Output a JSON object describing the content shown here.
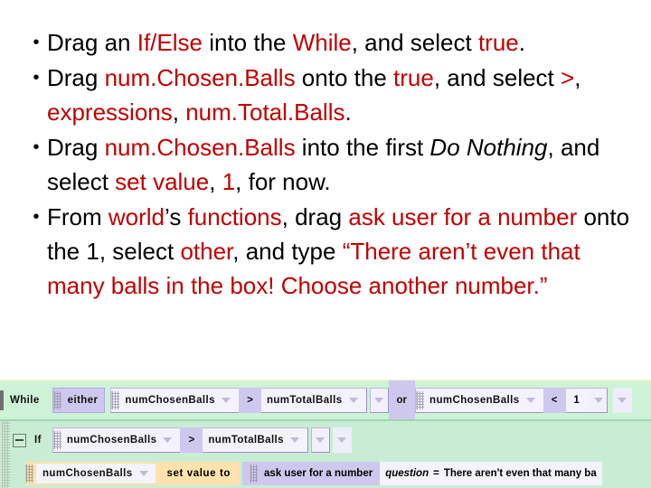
{
  "slide": {
    "bullets": [
      {
        "marker": "•",
        "runs": [
          {
            "t": "Drag an ",
            "s": "plain"
          },
          {
            "t": "If/Else",
            "s": "em"
          },
          {
            "t": " into the ",
            "s": "plain"
          },
          {
            "t": "While",
            "s": "em"
          },
          {
            "t": ", and select ",
            "s": "plain"
          },
          {
            "t": "true",
            "s": "em"
          },
          {
            "t": ".",
            "s": "plain"
          }
        ]
      },
      {
        "marker": "•",
        "runs": [
          {
            "t": "Drag ",
            "s": "plain"
          },
          {
            "t": "num.Chosen.Balls",
            "s": "em"
          },
          {
            "t": " onto the ",
            "s": "plain"
          },
          {
            "t": "true",
            "s": "em"
          },
          {
            "t": ", and select ",
            "s": "plain"
          },
          {
            "t": ">",
            "s": "em"
          },
          {
            "t": ", ",
            "s": "plain"
          },
          {
            "t": "expressions",
            "s": "em"
          },
          {
            "t": ", ",
            "s": "plain"
          },
          {
            "t": "num.Total.Balls",
            "s": "em"
          },
          {
            "t": ".",
            "s": "plain"
          }
        ]
      },
      {
        "marker": "•",
        "runs": [
          {
            "t": "Drag ",
            "s": "plain"
          },
          {
            "t": "num.Chosen.Balls",
            "s": "em"
          },
          {
            "t": " into the first ",
            "s": "plain"
          },
          {
            "t": "Do Nothing",
            "s": "it"
          },
          {
            "t": ", and select ",
            "s": "plain"
          },
          {
            "t": "set value",
            "s": "em"
          },
          {
            "t": ", ",
            "s": "plain"
          },
          {
            "t": "1",
            "s": "em"
          },
          {
            "t": ", for now.",
            "s": "plain"
          }
        ]
      },
      {
        "marker": "•",
        "runs": [
          {
            "t": "From ",
            "s": "plain"
          },
          {
            "t": "world",
            "s": "em"
          },
          {
            "t": "’s ",
            "s": "plain"
          },
          {
            "t": "functions",
            "s": "em"
          },
          {
            "t": ", drag ",
            "s": "plain"
          },
          {
            "t": "ask user for a number",
            "s": "em"
          },
          {
            "t": " onto the ",
            "s": "plain"
          },
          {
            "t": "1",
            "s": "plain"
          },
          {
            "t": ", select ",
            "s": "plain"
          },
          {
            "t": "other",
            "s": "em"
          },
          {
            "t": ", and type ",
            "s": "plain"
          },
          {
            "t": "“There aren’t even that many balls in the box! Choose another number.”",
            "s": "em"
          }
        ]
      }
    ]
  },
  "code": {
    "while_row": {
      "keyword": "While",
      "either_label": "either",
      "left_var": "numChosenBalls",
      "left_op": ">",
      "right_var": "numTotalBalls",
      "join": "or",
      "second_var": "numChosenBalls",
      "second_op": "<",
      "second_literal": "1"
    },
    "if_row": {
      "keyword": "If",
      "left_var": "numChosenBalls",
      "op": ">",
      "right_var": "numTotalBalls"
    },
    "set_row": {
      "target_var": "numChosenBalls",
      "set_label": "set value to",
      "function_label": "ask user for a number",
      "param_name": "question",
      "param_eq": "=",
      "param_value": "There aren't even that many ba"
    }
  },
  "colors": {
    "accent_red": "#C00000",
    "block_green": "#C9EDD4",
    "block_lavender": "#CFC8EE",
    "block_orange": "#FFE2AE",
    "tile_white": "#F2F0FB"
  }
}
